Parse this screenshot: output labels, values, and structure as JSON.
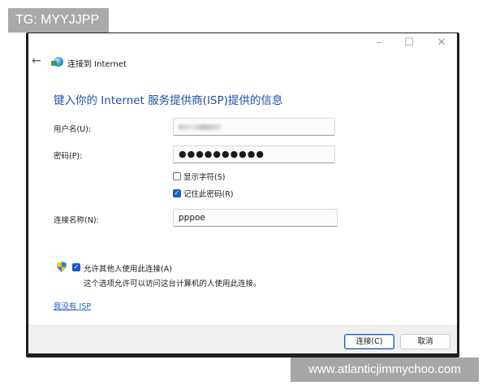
{
  "window": {
    "title": "连接到 Internet",
    "controls": {
      "minimize": "–",
      "maximize": "☐",
      "close": "✕"
    }
  },
  "heading": "键入你的 Internet 服务提供商(ISP)提供的信息",
  "form": {
    "username_label": "用户名(U):",
    "username_value": "",
    "password_label": "密码(P):",
    "password_value": "●●●●●●●●●●",
    "show_chars": {
      "label": "显示字符(S)",
      "checked": false
    },
    "remember_password": {
      "label": "记住此密码(R)",
      "checked": true
    },
    "connection_name_label": "连接名称(N):",
    "connection_name_value": "pppoe"
  },
  "allow_others": {
    "label": "允许其他人使用此连接(A)",
    "checked": true,
    "note": "这个选项允许可以访问这台计算机的人使用此连接。"
  },
  "no_isp_link": "我没有 ISP",
  "buttons": {
    "connect": "连接(C)",
    "cancel": "取消"
  },
  "icons": {
    "back": "back-arrow-icon",
    "title": "network-globe-icon",
    "shield": "uac-shield-icon"
  },
  "checkmark": "✓",
  "watermarks": {
    "top": "TG: MYYJJPP",
    "bottom": "www.atlanticjimmychoo.com"
  },
  "colors": {
    "heading": "#1f4fa0",
    "link": "#1f5bbf",
    "check_on": "#1f5bbf"
  }
}
